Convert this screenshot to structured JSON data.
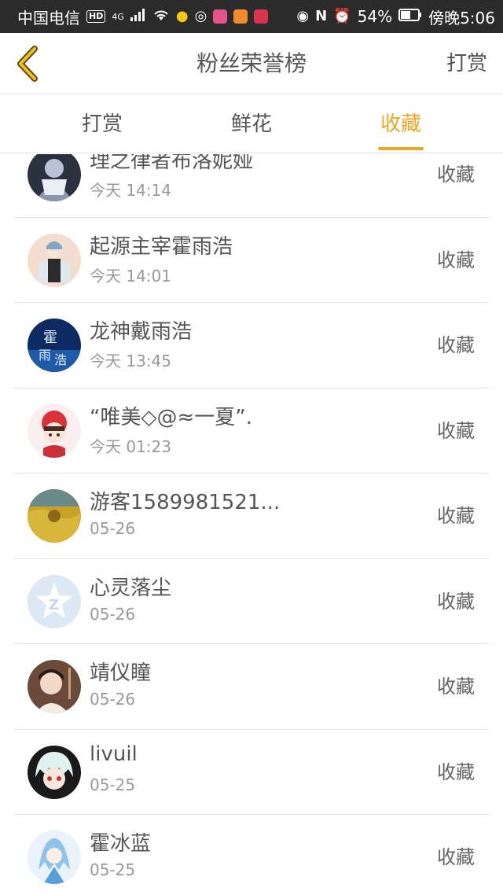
{
  "status_bar": {
    "carrier": "中国电信",
    "hd": "HD",
    "network": "4G",
    "battery": "54%",
    "time": "傍晚5:06"
  },
  "header": {
    "title": "粉丝荣誉榜",
    "right_action": "打赏"
  },
  "tabs": [
    {
      "label": "打赏",
      "active": false
    },
    {
      "label": "鲜花",
      "active": false
    },
    {
      "label": "收藏",
      "active": true
    }
  ],
  "accent_color": "#f0a526",
  "fans": [
    {
      "name": "理之律者布洛妮娅",
      "time": "今天 14:14",
      "action": "收藏"
    },
    {
      "name": "起源主宰霍雨浩",
      "time": "今天 14:01",
      "action": "收藏"
    },
    {
      "name": "龙神戴雨浩",
      "time": "今天 13:45",
      "action": "收藏"
    },
    {
      "name": "“唯美◇@≈一夏”.",
      "time": "今天 01:23",
      "action": "收藏"
    },
    {
      "name": "游客1589981521...",
      "time": "05-26",
      "action": "收藏"
    },
    {
      "name": "心灵落尘",
      "time": "05-26",
      "action": "收藏"
    },
    {
      "name": "靖仪瞳",
      "time": "05-26",
      "action": "收藏"
    },
    {
      "name": "livuil",
      "time": "05-25",
      "action": "收藏"
    },
    {
      "name": "霍冰蓝",
      "time": "05-25",
      "action": "收藏"
    }
  ]
}
